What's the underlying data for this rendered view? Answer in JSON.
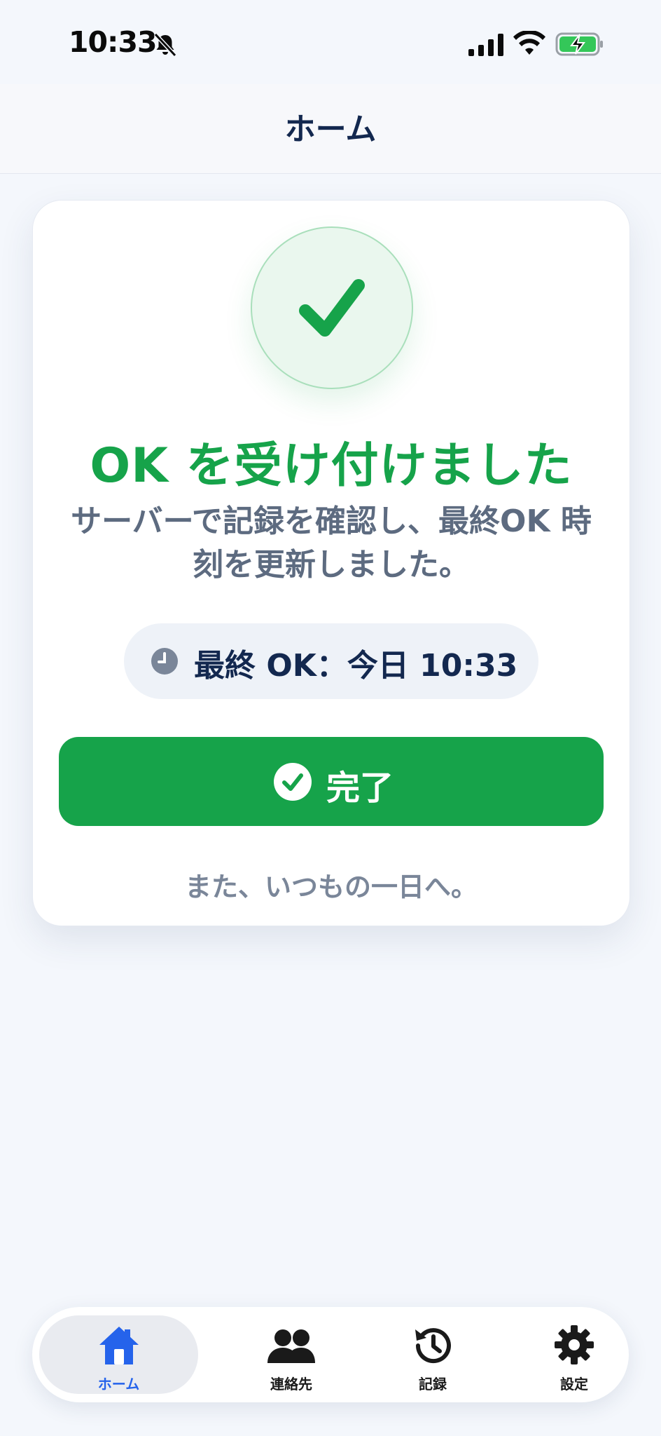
{
  "status_bar": {
    "time": "10:33",
    "icons": [
      "bell-slash-icon",
      "cellular-signal-icon",
      "wifi-icon",
      "battery-charging-icon"
    ]
  },
  "header": {
    "title": "ホーム"
  },
  "card": {
    "icon": "check-icon",
    "title": "OK を受け付けました",
    "message": "サーバーで記録を確認し、最終OK 時刻を更新しました。",
    "last_ok": {
      "icon": "clock-icon",
      "text": "最終 OK：今日 10:33"
    },
    "done_button": {
      "icon": "check-circle-icon",
      "label": "完了"
    },
    "footer": "また、いつもの一日へ。"
  },
  "tab_bar": {
    "active_index": 0,
    "items": [
      {
        "label": "ホーム",
        "icon": "home-icon"
      },
      {
        "label": "連絡先",
        "icon": "contacts-icon"
      },
      {
        "label": "記録",
        "icon": "history-icon"
      },
      {
        "label": "設定",
        "icon": "gear-icon"
      }
    ]
  },
  "colors": {
    "accent_green": "#16a34a",
    "active_tab_blue": "#2563eb",
    "title_navy": "#13284f",
    "background": "#f4f7fc"
  }
}
